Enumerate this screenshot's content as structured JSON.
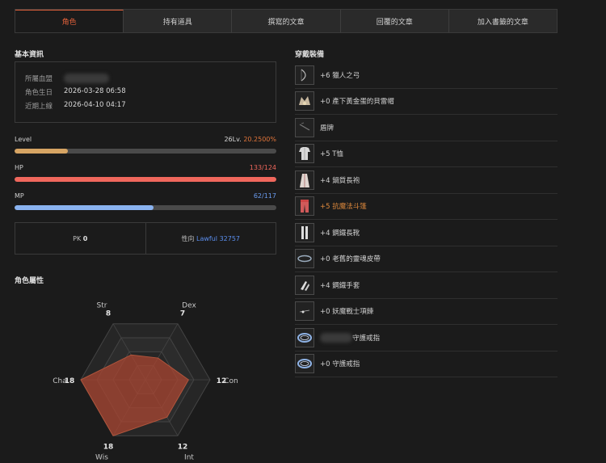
{
  "tabs": [
    {
      "label": "角色",
      "active": true
    },
    {
      "label": "持有道具",
      "active": false
    },
    {
      "label": "撰寫的文章",
      "active": false
    },
    {
      "label": "回覆的文章",
      "active": false
    },
    {
      "label": "加入書籤的文章",
      "active": false
    }
  ],
  "basic_info": {
    "title": "基本資訊",
    "clan_label": "所屬血盟",
    "birth_label": "角色生日",
    "birth_value": "2026-03-28 06:58",
    "login_label": "近期上線",
    "login_value": "2026-04-10 04:17"
  },
  "stats": {
    "level": {
      "label": "Level",
      "value_text": "26Lv.",
      "percent_text": "20.2500%",
      "fill": 0.2025,
      "color": "#d6a463"
    },
    "hp": {
      "label": "HP",
      "value_text": "133/124",
      "fill": 1.0,
      "color": "#f0675c",
      "text_color": "#f0675c"
    },
    "mp": {
      "label": "MP",
      "value_text": "62/117",
      "fill": 0.53,
      "color": "#8ab3f0",
      "text_color": "#6a9cf0"
    }
  },
  "pk": {
    "label": "PK",
    "value": "0"
  },
  "alignment": {
    "label": "性向",
    "value": "Lawful 32757",
    "color": "#5b8ff0"
  },
  "attributes": {
    "title": "角色屬性",
    "max": 18,
    "axes": [
      {
        "name": "Str",
        "value": 8
      },
      {
        "name": "Dex",
        "value": 7
      },
      {
        "name": "Con",
        "value": 12
      },
      {
        "name": "Int",
        "value": 12
      },
      {
        "name": "Wis",
        "value": 18
      },
      {
        "name": "Cha",
        "value": 18
      }
    ]
  },
  "equipment": {
    "title": "穿戴裝備",
    "items": [
      {
        "name": "+6 獵人之弓",
        "icon": "bow-icon",
        "highlight": false
      },
      {
        "name": "+0 產下黃金蛋的貝雷帽",
        "icon": "beret-icon",
        "highlight": false
      },
      {
        "name": "盾牌",
        "icon": "shield-icon",
        "highlight": false
      },
      {
        "name": "+5 T恤",
        "icon": "tshirt-icon",
        "highlight": false
      },
      {
        "name": "+4 鍋質長袍",
        "icon": "robe-icon",
        "highlight": false
      },
      {
        "name": "+5 抗魔法斗篷",
        "icon": "cloak-icon",
        "highlight": true
      },
      {
        "name": "+4 鋼鐵長靴",
        "icon": "boots-icon",
        "highlight": false
      },
      {
        "name": "+0 老舊的靈魂皮帶",
        "icon": "belt-icon",
        "highlight": false
      },
      {
        "name": "+4 鋼鐵手套",
        "icon": "gloves-icon",
        "highlight": false
      },
      {
        "name": "+0 妖魔戰士項鍊",
        "icon": "necklace-icon",
        "highlight": false
      },
      {
        "name": "守護戒指",
        "icon": "ring-icon",
        "highlight": false,
        "blurred_prefix": true
      },
      {
        "name": "+0 守護戒指",
        "icon": "ring-icon",
        "highlight": false
      }
    ]
  }
}
